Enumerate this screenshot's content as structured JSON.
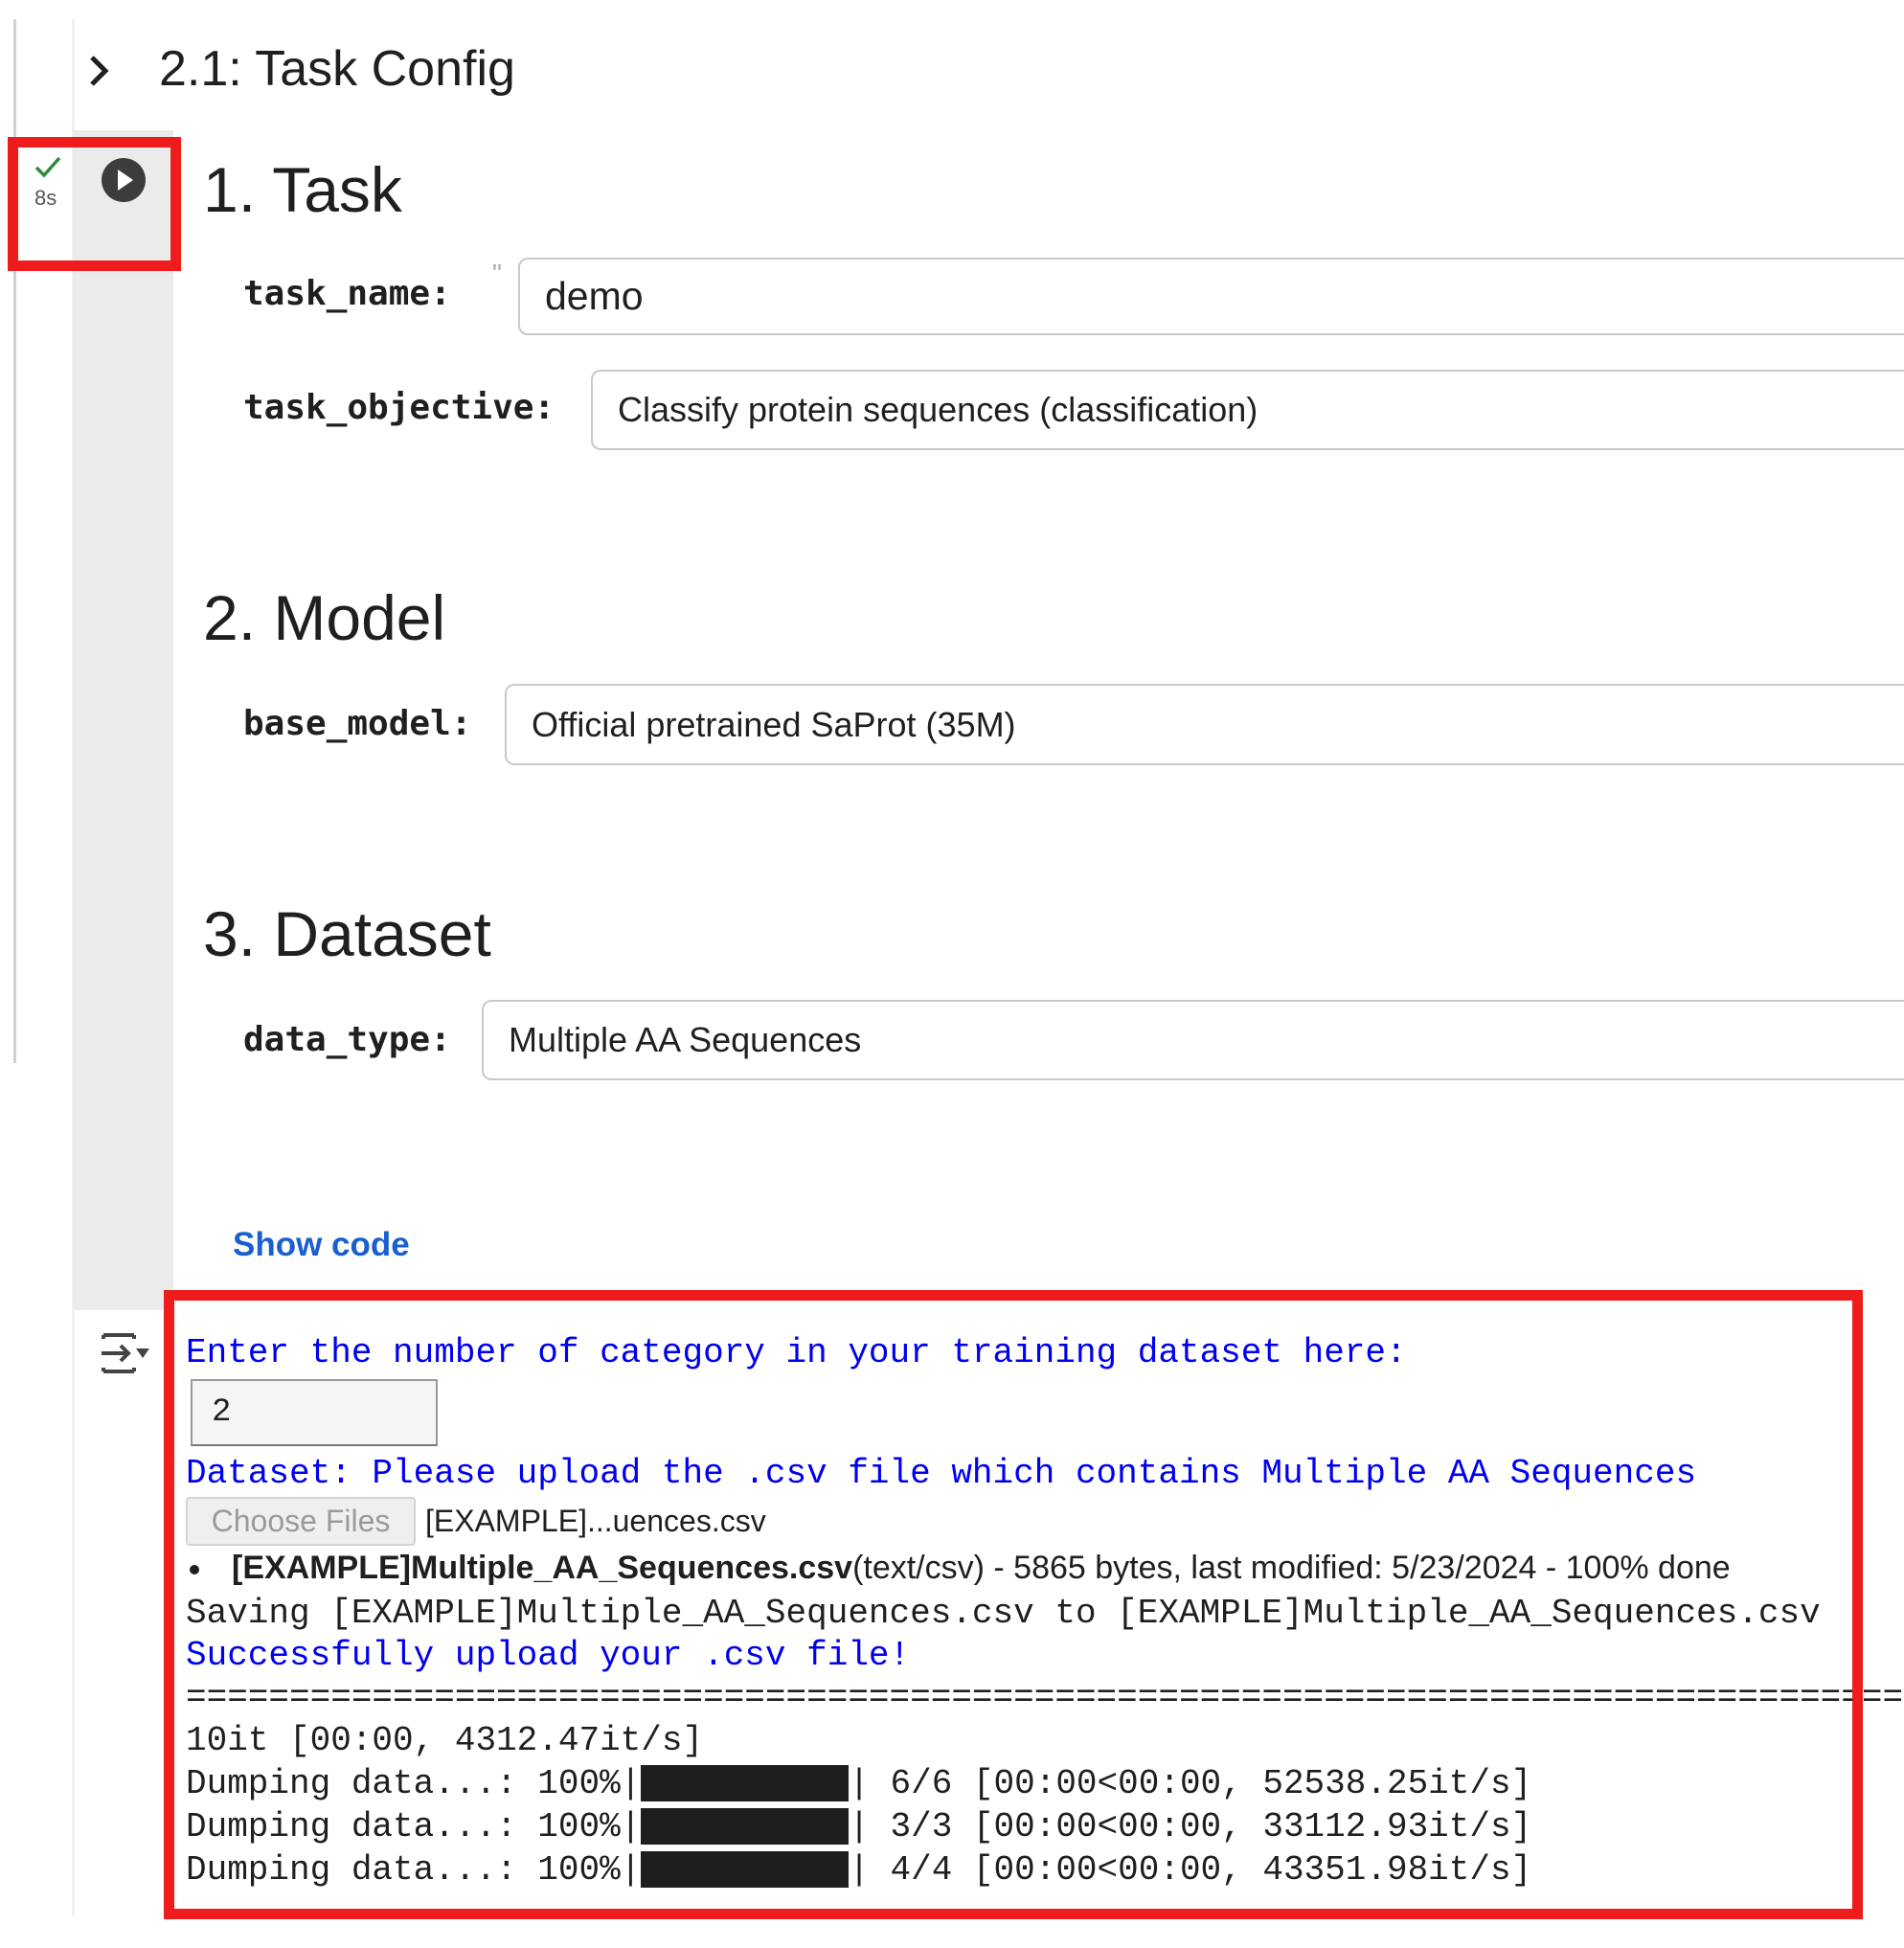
{
  "section": {
    "title": "2.1: Task Config"
  },
  "cell": {
    "status": "8s",
    "run_icon": "play-circle-icon",
    "status_icon": "check-icon"
  },
  "form": {
    "task_heading": "1. Task",
    "task_name_label": "task_name:",
    "task_name_marker": "\"",
    "task_name_value": "demo",
    "task_objective_label": "task_objective:",
    "task_objective_value": "Classify protein sequences (classification)",
    "model_heading": "2. Model",
    "base_model_label": "base_model:",
    "base_model_value": "Official pretrained SaProt (35M)",
    "dataset_heading": "3. Dataset",
    "data_type_label": "data_type:",
    "data_type_value": "Multiple AA Sequences",
    "show_code": "Show code"
  },
  "output": {
    "prompt": "Enter the number of category in your training dataset here:",
    "category_input": "2",
    "upload_prompt": "Dataset: Please upload the .csv file which contains Multiple AA Sequences",
    "choose_files": "Choose Files",
    "chosen_file": "[EXAMPLE]...uences.csv",
    "file_name": "[EXAMPLE]Multiple_AA_Sequences.csv",
    "file_info": "(text/csv) - 5865 bytes, last modified: 5/23/2024 - 100% done",
    "saving": "Saving [EXAMPLE]Multiple_AA_Sequences.csv to [EXAMPLE]Multiple_AA_Sequences.csv",
    "success": "Successfully upload your .csv file!",
    "separator": "====================================================================================================",
    "iter_line": "10it [00:00, 4312.47it/s]",
    "progress": [
      {
        "label": "Dumping data...: 100%|",
        "percent": 100,
        "stats": "| 6/6 [00:00<00:00, 52538.25it/s]"
      },
      {
        "label": "Dumping data...: 100%|",
        "percent": 100,
        "stats": "| 3/3 [00:00<00:00, 33112.93it/s]"
      },
      {
        "label": "Dumping data...: 100%|",
        "percent": 100,
        "stats": "| 4/4 [00:00<00:00, 43351.98it/s]"
      }
    ]
  },
  "colors": {
    "highlight": "#ee1c1c",
    "output_blue": "#0000ee",
    "link": "#1a5fd0"
  }
}
